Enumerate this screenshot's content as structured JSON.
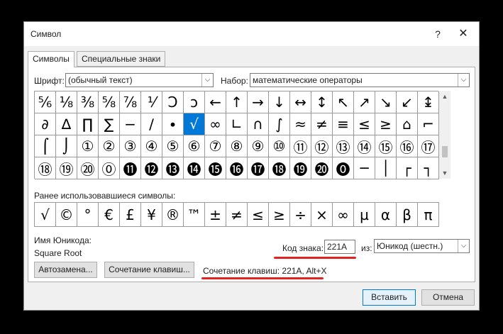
{
  "window": {
    "title": "Символ",
    "help": "?",
    "close": "✕"
  },
  "tabs": [
    {
      "label": "Символы",
      "active": true
    },
    {
      "label": "Специальные знаки",
      "active": false
    }
  ],
  "font_label": "Шрифт:",
  "font_value": "(обычный текст)",
  "subset_label": "Набор:",
  "subset_value": "математические операторы",
  "symbols": [
    [
      "⅚",
      "⅛",
      "⅜",
      "⅝",
      "⅞",
      "⅟",
      "Ↄ",
      "ↄ",
      "←",
      "↑",
      "→",
      "↓",
      "↔",
      "↕",
      "↖",
      "↗",
      "↘",
      "↙",
      "↨"
    ],
    [
      "∂",
      "∆",
      "∏",
      "∑",
      "−",
      "∕",
      "∙",
      "√",
      "∞",
      "∟",
      "∩",
      "∫",
      "≈",
      "≠",
      "≡",
      "≤",
      "≥",
      "⌂",
      "⌐"
    ],
    [
      "⌠",
      "⌡",
      "①",
      "②",
      "③",
      "④",
      "⑤",
      "⑥",
      "⑦",
      "⑧",
      "⑨",
      "⑩",
      "⑪",
      "⑫",
      "⑬",
      "⑭",
      "⑮",
      "⑯",
      "⑰"
    ],
    [
      "⑱",
      "⑲",
      "⑳",
      "⓪",
      "⓫",
      "⓬",
      "⓭",
      "⓮",
      "⓯",
      "⓰",
      "⓱",
      "⓲",
      "⓳",
      "⓴",
      "⓿",
      "─",
      "│",
      "┌",
      "┐"
    ]
  ],
  "selected_symbol": "√",
  "scroll_up": "▲",
  "scroll_down": "▼",
  "recent_label": "Ранее использовавшиеся символы:",
  "recent_symbols": [
    "√",
    "©",
    "°",
    "€",
    "£",
    "¥",
    "®",
    "™",
    "±",
    "≠",
    "≤",
    "≥",
    "÷",
    "×",
    "∞",
    "µ",
    "α",
    "β",
    "π"
  ],
  "unicode_name_label": "Имя Юникода:",
  "unicode_name_value": "Square Root",
  "char_code_label": "Код знака:",
  "char_code_value": "221A",
  "from_label": "из:",
  "from_value": "Юникод (шестн.)",
  "autocorrect_button": "Автозамена...",
  "shortcut_button": "Сочетание клавиш...",
  "shortcut_info": "Сочетание клавиш: 221A, Alt+X",
  "insert_button": "Вставить",
  "cancel_button": "Отмена",
  "highlight_color": "#e02424",
  "selected_color": "#0078d7"
}
